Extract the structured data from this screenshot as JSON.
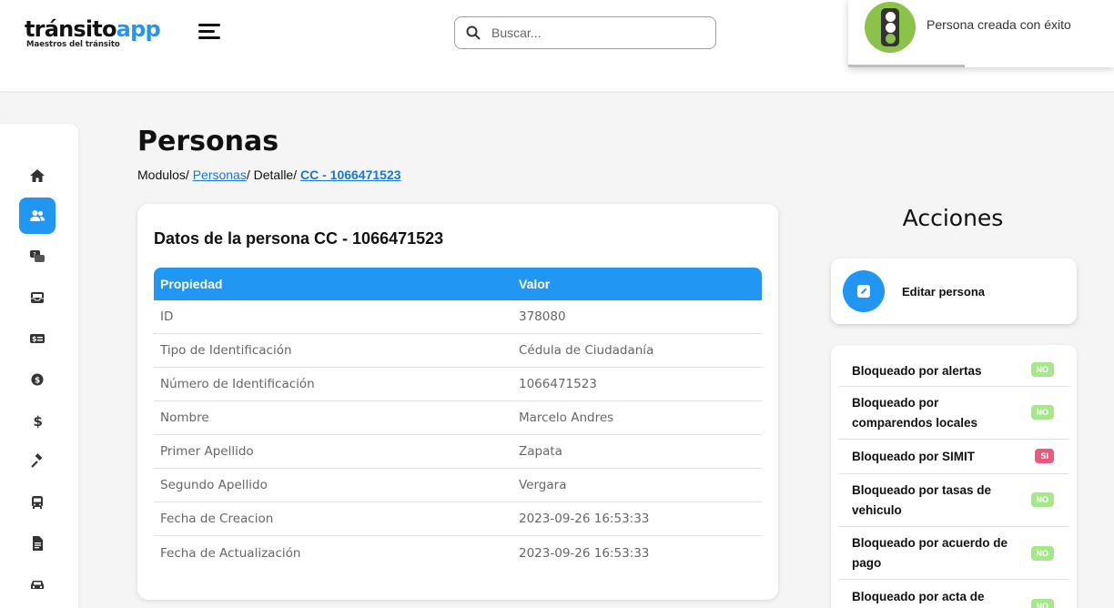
{
  "header": {
    "logo_main_a": "tránsito",
    "logo_main_b": "app",
    "logo_sub": "Maestros del tránsito",
    "search_placeholder": "Buscar..."
  },
  "toast": {
    "message": "Persona creada con éxito",
    "icon": "traffic-light-icon",
    "color": "#8bc34a"
  },
  "sidebar": {
    "items": [
      {
        "icon": "home-icon",
        "active": false
      },
      {
        "icon": "users-icon",
        "active": true
      },
      {
        "icon": "chat-icon",
        "active": false
      },
      {
        "icon": "inbox-icon",
        "active": false
      },
      {
        "icon": "id-card-icon",
        "active": false
      },
      {
        "icon": "money-bag-icon",
        "active": false
      },
      {
        "icon": "dollar-icon",
        "active": false
      },
      {
        "icon": "gavel-icon",
        "active": false
      },
      {
        "icon": "bus-icon",
        "active": false
      },
      {
        "icon": "document-icon",
        "active": false
      },
      {
        "icon": "car-icon",
        "active": false
      }
    ]
  },
  "page": {
    "title": "Personas",
    "breadcrumb": {
      "modulos": "Modulos/",
      "personas": "Personas",
      "detalle": "/ Detalle/",
      "current": "CC - 1066471523"
    }
  },
  "details": {
    "title": "Datos de la persona CC - 1066471523",
    "columns": [
      "Propiedad",
      "Valor"
    ],
    "rows": [
      [
        "ID",
        "378080"
      ],
      [
        "Tipo de Identificación",
        "Cédula de Ciudadanía"
      ],
      [
        "Número de Identificación",
        "1066471523"
      ],
      [
        "Nombre",
        "Marcelo Andres"
      ],
      [
        "Primer Apellido",
        "Zapata"
      ],
      [
        "Segundo Apellido",
        "Vergara"
      ],
      [
        "Fecha de Creacion",
        "2023-09-26 16:53:33"
      ],
      [
        "Fecha de Actualización",
        "2023-09-26 16:53:33"
      ]
    ]
  },
  "actions": {
    "title": "Acciones",
    "edit_label": "Editar persona",
    "blocks": [
      {
        "label": "Bloqueado por alertas",
        "status": "NO"
      },
      {
        "label": "Bloqueado por comparendos locales",
        "status": "NO"
      },
      {
        "label": "Bloqueado por SIMIT",
        "status": "SI"
      },
      {
        "label": "Bloqueado por tasas de vehiculo",
        "status": "NO"
      },
      {
        "label": "Bloqueado por acuerdo de pago",
        "status": "NO"
      },
      {
        "label": "Bloqueado por acta de",
        "status": "NO"
      }
    ]
  },
  "colors": {
    "accent": "#2196f3",
    "badge_no": "#a5e88a",
    "badge_si": "#f0577a"
  }
}
